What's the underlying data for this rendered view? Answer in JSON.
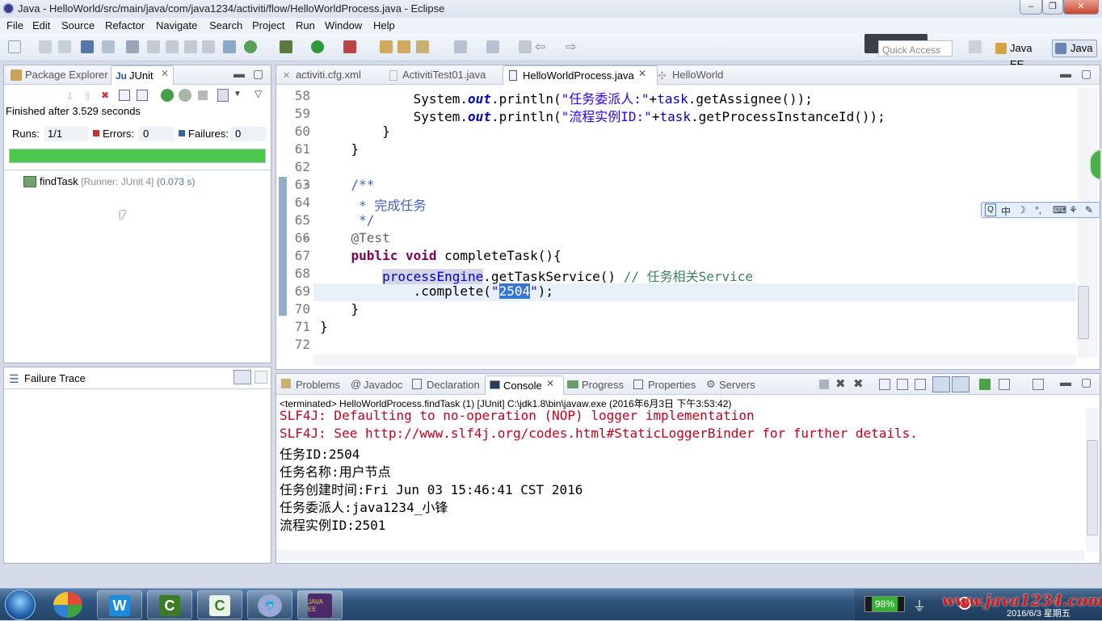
{
  "window": {
    "title": "Java - HelloWorld/src/main/java/com/java1234/activiti/flow/HelloWorldProcess.java - Eclipse",
    "min": "–",
    "max": "❐",
    "close": "✕"
  },
  "menu": [
    "File",
    "Edit",
    "Source",
    "Refactor",
    "Navigate",
    "Search",
    "Project",
    "Run",
    "Window",
    "Help"
  ],
  "quick_access": {
    "placeholder": "Quick Access"
  },
  "perspectives": [
    "Java EE",
    "Java"
  ],
  "left_tabs": [
    "Package Explorer",
    "JUnit"
  ],
  "junit": {
    "finished": "Finished after 3.529 seconds",
    "runs_label": "Runs:",
    "runs_value": "1/1",
    "errors_label": "Errors:",
    "errors_value": "0",
    "failures_label": "Failures:",
    "failures_value": "0",
    "progress": 1.0,
    "bar_color": "#4cc94c",
    "test_name": "findTask",
    "test_detail": "[Runner: JUnit 4]",
    "test_time": "(0.073 s)",
    "failure_trace": "Failure Trace"
  },
  "editor_tabs": [
    "activiti.cfg.xml",
    "ActivitiTest01.java",
    "HelloWorldProcess.java",
    "HelloWorld"
  ],
  "code": {
    "lines": [
      "58",
      "59",
      "60",
      "61",
      "62",
      "63",
      "64",
      "65",
      "66",
      "67",
      "68",
      "69",
      "70",
      "71",
      "72"
    ],
    "l58a": "            System.",
    "l58b": "out",
    "l58c": ".println(",
    "l58d": "\"任务委派人:\"",
    "l58e": "+",
    "l58f": "task",
    "l58g": ".getAssignee());",
    "l59a": "            System.",
    "l59b": "out",
    "l59c": ".println(",
    "l59d": "\"流程实例ID:\"",
    "l59e": "+",
    "l59f": "task",
    "l59g": ".getProcessInstanceId());",
    "l60": "        }",
    "l61": "    }",
    "l63": "    /**",
    "l64": "     * 完成任务",
    "l65": "     */",
    "l66": "    @Test",
    "l67a": "    ",
    "l67b": "public void",
    "l67c": " completeTask(){",
    "l68a": "        ",
    "l68b": "processEngine",
    "l68c": ".getTaskService() ",
    "l68d": "// 任务相关Service",
    "l69a": "            .complete(",
    "l69b": "\"",
    "l69c": "2504",
    "l69d": "\"",
    ");": ");",
    "l70": "    }",
    "l71": "}"
  },
  "ime_bar": [
    "中",
    "☽",
    "°,",
    "⌨",
    "⚘",
    "✎"
  ],
  "bottom_tabs": [
    "Problems",
    "Javadoc",
    "Declaration",
    "Console",
    "Progress",
    "Properties",
    "Servers"
  ],
  "console": {
    "header": "<terminated> HelloWorldProcess.findTask (1) [JUnit] C:\\jdk1.8\\bin\\javaw.exe (2016年6月3日 下午3:53:42)",
    "lines": [
      "SLF4J: Defaulting to no-operation (NOP) logger implementation",
      "SLF4J: See http://www.slf4j.org/codes.html#StaticLoggerBinder for further details.",
      "任务ID:2504",
      "任务名称:用户节点",
      "任务创建时间:Fri Jun 03 15:46:41 CST 2016",
      "任务委派人:java1234_小锋",
      "流程实例ID:2501"
    ]
  },
  "taskbar": {
    "battery": "98%",
    "watermark": "www.java1234.com",
    "date": "2016/6/3 星期五"
  },
  "colors": {
    "keyword": "#7f0055",
    "string": "#2a00ff",
    "comment": "#3f7f5f",
    "error": "#c8001c",
    "accent": "#4cc94c"
  }
}
